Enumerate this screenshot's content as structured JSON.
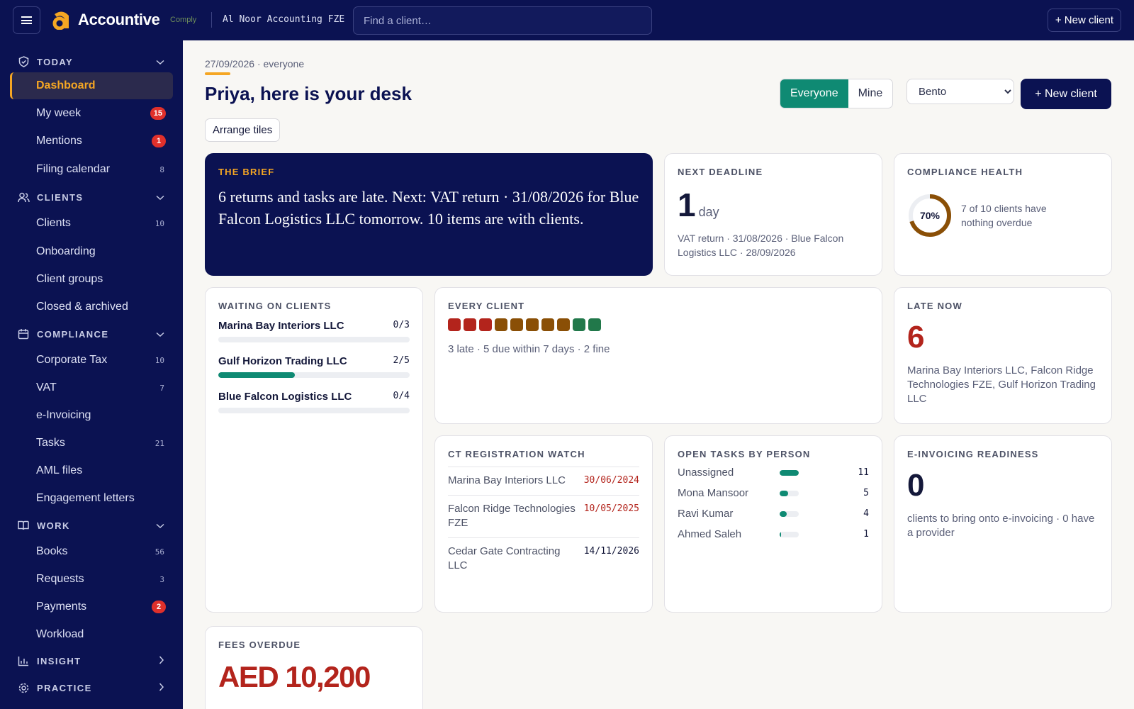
{
  "topbar": {
    "brand": "Accountive",
    "brand_sub": "Comply",
    "firm": "Al Noor Accounting FZE",
    "search_placeholder": "Find a client…",
    "new_client": "+ New client"
  },
  "sidebar": {
    "sections": [
      {
        "label": "TODAY",
        "icon": "shield-icon"
      },
      {
        "label": "CLIENTS",
        "icon": "users-icon"
      },
      {
        "label": "COMPLIANCE",
        "icon": "calendar-icon"
      },
      {
        "label": "WORK",
        "icon": "book-icon"
      },
      {
        "label": "INSIGHT",
        "icon": "chart-icon"
      },
      {
        "label": "PRACTICE",
        "icon": "gear-icon"
      }
    ],
    "items": [
      {
        "label": "Dashboard",
        "count": ""
      },
      {
        "label": "My week",
        "count": "15"
      },
      {
        "label": "Mentions",
        "count": "1"
      },
      {
        "label": "Filing calendar",
        "count": "8"
      },
      {
        "label": "Clients",
        "count": "10"
      },
      {
        "label": "Onboarding",
        "count": ""
      },
      {
        "label": "Client groups",
        "count": ""
      },
      {
        "label": "Closed & archived",
        "count": ""
      },
      {
        "label": "Corporate Tax",
        "count": "10"
      },
      {
        "label": "VAT",
        "count": "7"
      },
      {
        "label": "e-Invoicing",
        "count": ""
      },
      {
        "label": "Tasks",
        "count": "21"
      },
      {
        "label": "AML files",
        "count": ""
      },
      {
        "label": "Engagement letters",
        "count": ""
      },
      {
        "label": "Books",
        "count": "56"
      },
      {
        "label": "Requests",
        "count": "3"
      },
      {
        "label": "Payments",
        "count": "2"
      },
      {
        "label": "Workload",
        "count": ""
      }
    ]
  },
  "header": {
    "date_line": "27/09/2026 · everyone",
    "title": "Priya, here is your desk",
    "seg_everyone": "Everyone",
    "seg_mine": "Mine",
    "view_selected": "Bento",
    "new_client": "+ New client",
    "arrange": "Arrange tiles"
  },
  "brief": {
    "heading": "THE BRIEF",
    "text": "6 returns and tasks are late. Next: VAT return · 31/08/2026 for Blue Falcon Logistics LLC tomorrow. 10 items are with clients."
  },
  "next_deadline": {
    "heading": "NEXT DEADLINE",
    "value": "1",
    "unit": "day",
    "detail": "VAT return · 31/08/2026 · Blue Falcon Logistics LLC · 28/09/2026"
  },
  "compliance_health": {
    "heading": "COMPLIANCE HEALTH",
    "percent": 70,
    "percent_label": "70%",
    "detail": "7 of 10 clients have nothing overdue",
    "color": "#8a4f06"
  },
  "waiting": {
    "heading": "WAITING ON CLIENTS",
    "rows": [
      {
        "name": "Marina Bay Interiors LLC",
        "ratio": "0/3",
        "done": 0,
        "total": 3
      },
      {
        "name": "Gulf Horizon Trading LLC",
        "ratio": "2/5",
        "done": 2,
        "total": 5
      },
      {
        "name": "Blue Falcon Logistics LLC",
        "ratio": "0/4",
        "done": 0,
        "total": 4
      }
    ]
  },
  "every_client": {
    "heading": "EVERY CLIENT",
    "statuses": [
      "late",
      "late",
      "late",
      "due",
      "due",
      "due",
      "due",
      "due",
      "fine",
      "fine"
    ],
    "colors": {
      "late": "#b3241c",
      "due": "#8a4f06",
      "fine": "#21784a"
    },
    "summary": "3 late · 5 due within 7 days · 2 fine"
  },
  "late_now": {
    "heading": "LATE NOW",
    "value": "6",
    "detail": "Marina Bay Interiors LLC, Falcon Ridge Technologies FZE, Gulf Horizon Trading LLC"
  },
  "ct_watch": {
    "heading": "CT REGISTRATION WATCH",
    "rows": [
      {
        "name": "Marina Bay Interiors LLC",
        "date": "30/06/2024",
        "late": true
      },
      {
        "name": "Falcon Ridge Technologies FZE",
        "date": "10/05/2025",
        "late": true
      },
      {
        "name": "Cedar Gate Contracting LLC",
        "date": "14/11/2026",
        "late": false
      }
    ]
  },
  "open_tasks": {
    "heading": "OPEN TASKS BY PERSON",
    "max": 11,
    "rows": [
      {
        "name": "Unassigned",
        "value": "11",
        "n": 11
      },
      {
        "name": "Mona Mansoor",
        "value": "5",
        "n": 5
      },
      {
        "name": "Ravi Kumar",
        "value": "4",
        "n": 4
      },
      {
        "name": "Ahmed Saleh",
        "value": "1",
        "n": 1
      }
    ]
  },
  "einvoicing": {
    "heading": "E-INVOICING READINESS",
    "value": "0",
    "detail": "clients to bring onto e-invoicing · 0 have a provider"
  },
  "fees": {
    "heading": "FEES OVERDUE",
    "value": "AED 10,200"
  },
  "colors": {
    "navy": "#0b1252",
    "accent": "#f5a623",
    "teal": "#0f8a73",
    "red": "#b3241c",
    "badge": "#e0302b"
  }
}
